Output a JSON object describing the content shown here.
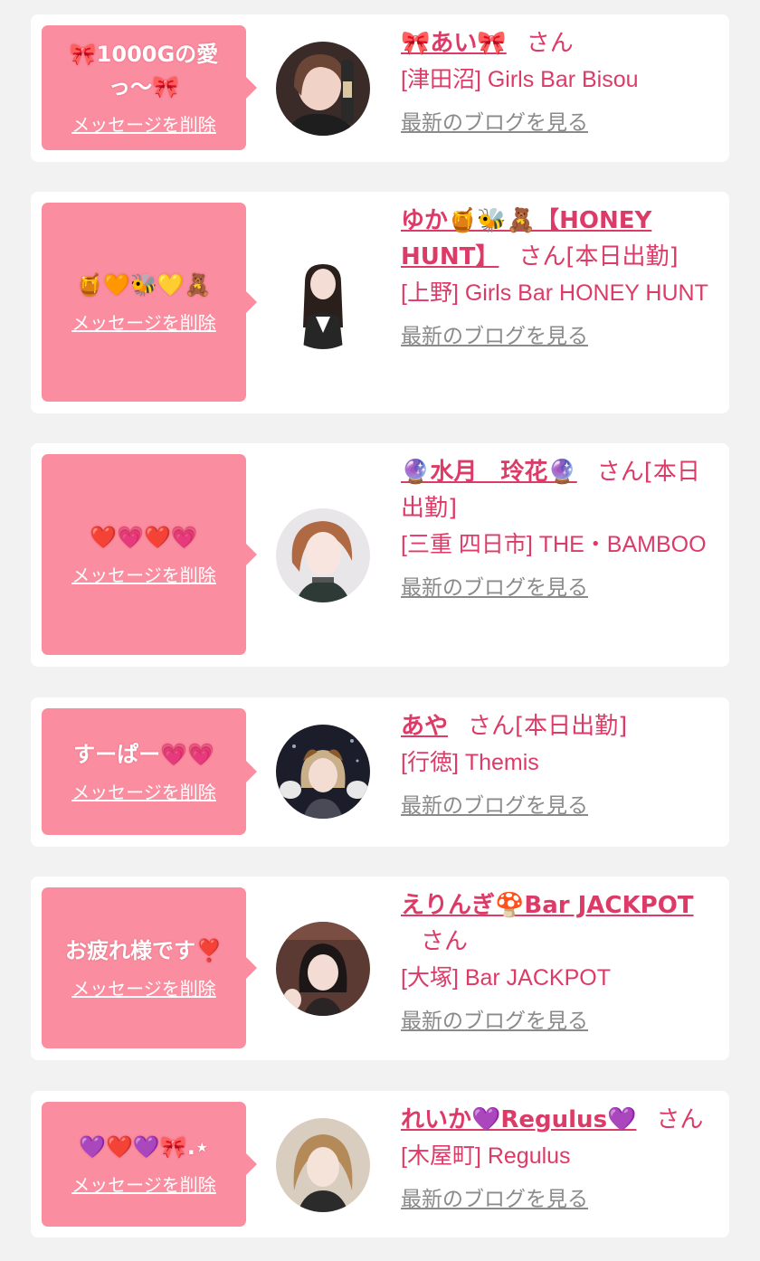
{
  "cards": [
    {
      "message": "🎀1000Gの愛っ〜🎀",
      "delete_label": "メッセージを削除",
      "girl_name": "🎀あい🎀",
      "san": "さん",
      "status": "",
      "shop": "[津田沼] Girls Bar Bisou",
      "blog_label": "最新のブログを見る",
      "avatar_icon": "girl-photo"
    },
    {
      "message": "🍯🧡🐝💛🧸",
      "delete_label": "メッセージを削除",
      "girl_name": "ゆか🍯🐝🧸【HONEY HUNT】",
      "san": "さん",
      "status": "[本日出勤]",
      "shop": "[上野] Girls Bar HONEY HUNT",
      "blog_label": "最新のブログを見る",
      "avatar_icon": "girl-photo"
    },
    {
      "message": "❤️💗❤️💗",
      "delete_label": "メッセージを削除",
      "girl_name": "🔮水月　玲花🔮",
      "san": "さん",
      "status": "[本日出勤]",
      "shop": "[三重 四日市] THE・BAMBOO",
      "blog_label": "最新のブログを見る",
      "avatar_icon": "girl-photo"
    },
    {
      "message": "すーぱー💗💗",
      "delete_label": "メッセージを削除",
      "girl_name": "あや",
      "san": "さん",
      "status": "[本日出勤]",
      "shop": "[行徳] Themis",
      "blog_label": "最新のブログを見る",
      "avatar_icon": "girl-photo"
    },
    {
      "message": "お疲れ様です❣️",
      "delete_label": "メッセージを削除",
      "girl_name": "えりんぎ🍄Bar JACKPOT",
      "san": "さん",
      "status": "",
      "shop": "[大塚] Bar JACKPOT",
      "blog_label": "最新のブログを見る",
      "avatar_icon": "girl-photo"
    },
    {
      "message": "💜❤️💜🎀.⋆",
      "delete_label": "メッセージを削除",
      "girl_name": "れいか💜Regulus💜",
      "san": "さん",
      "status": "",
      "shop": "[木屋町] Regulus",
      "blog_label": "最新のブログを見る",
      "avatar_icon": "girl-photo"
    }
  ],
  "colors": {
    "bubble": "#fb8da0",
    "accent": "#dd3b67",
    "link_gray": "#8a8a8a"
  }
}
